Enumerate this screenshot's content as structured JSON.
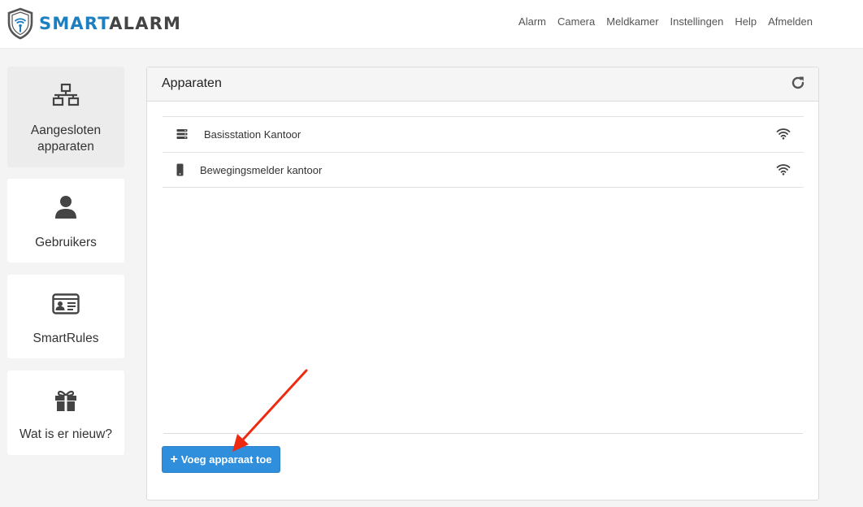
{
  "brand": {
    "part1": "SMART",
    "part2": "ALARM"
  },
  "nav": {
    "items": [
      "Alarm",
      "Camera",
      "Meldkamer",
      "Instellingen",
      "Help",
      "Afmelden"
    ]
  },
  "sidebar": {
    "items": [
      {
        "label": "Aangesloten apparaten",
        "icon": "network-icon",
        "active": true
      },
      {
        "label": "Gebruikers",
        "icon": "user-icon"
      },
      {
        "label": "SmartRules",
        "icon": "id-card-icon"
      },
      {
        "label": "Wat is er nieuw?",
        "icon": "gift-icon"
      }
    ]
  },
  "panel": {
    "title": "Apparaten",
    "devices": [
      {
        "name": "Basisstation Kantoor",
        "icon": "server-icon",
        "status_icon": "wifi-icon"
      },
      {
        "name": "Bewegingsmelder kantoor",
        "icon": "mobile-icon",
        "status_icon": "wifi-icon"
      }
    ],
    "add_button": {
      "plus": "+",
      "label": "Voeg apparaat toe"
    }
  },
  "colors": {
    "accent": "#2f8fdd",
    "brand_blue": "#1e7fc0",
    "annotation": "#ee2a10"
  }
}
